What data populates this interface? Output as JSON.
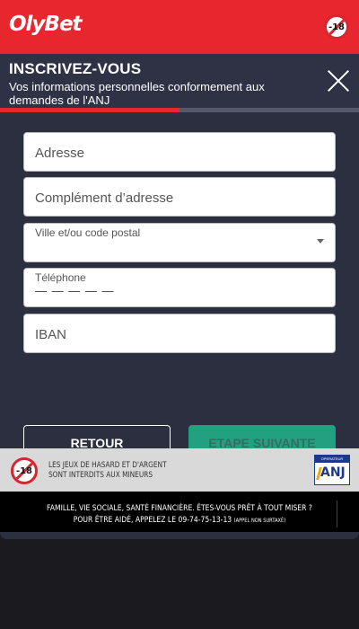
{
  "header": {
    "brand": "OlyBet",
    "age_badge": "-18"
  },
  "modal": {
    "title": "INSCRIVEZ-VOUS",
    "subtitle": "Vos informations personnelles conformement aux demandes de l'ANJ",
    "close_icon": "close-icon",
    "progress_percent": 50,
    "progress_color": "#e8262d"
  },
  "form": {
    "address_placeholder": "Adresse",
    "address_extra_placeholder": "Complément d’adresse",
    "city_label": "Ville et/ou code postal",
    "phone_label": "Téléphone",
    "phone_mask": "— — — — —",
    "iban_placeholder": "IBAN"
  },
  "buttons": {
    "back_label": "RETOUR",
    "next_label": "ETAPE SUIVANTE",
    "next_color": "#23a07f"
  },
  "warning": {
    "age_badge": "-18",
    "line1": "LES JEUX DE HASARD ET D'ARGENT",
    "line2": "SONT INTERDITS AUX MINEURS",
    "anj_top": "OPERATEUR AGREE",
    "anj_logo": "ANJ"
  },
  "footer": {
    "line1": "FAMILLE, VIE SOCIALE, SANTÉ FINANCIÈRE. ÊTES-VOUS PRÊT À TOUT MISER ?",
    "line2": "POUR ÊTRE AIDÉ, APPELEZ LE 09-74-75-13-13",
    "line2_note": "(APPEL NON SURTAXÉ)"
  },
  "colors": {
    "brand_red": "#e8262d",
    "modal_bg": "#2e3244",
    "page_bg": "#1b1b1f"
  }
}
